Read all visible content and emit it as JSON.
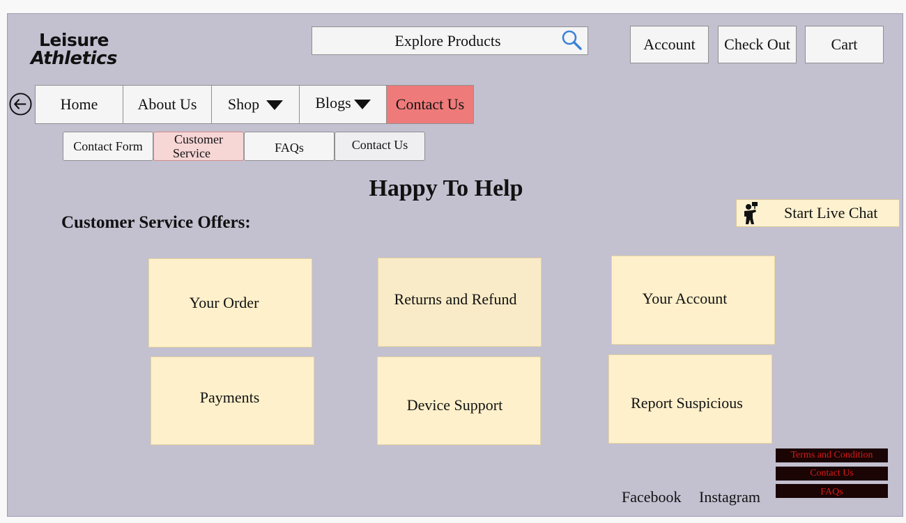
{
  "brand": {
    "line1": "Leisure",
    "line2": "Athletics"
  },
  "search": {
    "label": "Explore Products",
    "icon": "search-icon"
  },
  "header_buttons": {
    "account": "Account",
    "checkout": "Check Out",
    "cart": "Cart"
  },
  "nav": {
    "back_icon": "arrow-left-circle-icon",
    "items": [
      {
        "label": "Home"
      },
      {
        "label": "About Us"
      },
      {
        "label": "Shop"
      },
      {
        "label": "Blogs"
      },
      {
        "label": "Contact Us"
      }
    ]
  },
  "subnav": {
    "contact_form": "Contact Form",
    "customer_service_1": "Customer",
    "customer_service_2": "Service",
    "faqs": "FAQs",
    "contact_us": "Contact Us"
  },
  "main": {
    "title": "Happy To Help",
    "offers_heading": "Customer Service Offers:",
    "live_chat": "Start Live Chat",
    "cards": [
      "Your Order",
      "Returns and Refund",
      "Your Account",
      "Payments",
      "Device Support",
      "Report Suspicious"
    ]
  },
  "footer": {
    "facebook": "Facebook",
    "instagram": "Instagram",
    "terms": "Terms and Condition",
    "contact": "Contact Us",
    "faqs": "FAQs"
  },
  "colors": {
    "background": "#c3c0d0",
    "active_nav": "#ef7a7a",
    "active_subnav": "#f7d6d6",
    "card": "#fef0cb",
    "footer_link_bg": "#1a0404",
    "footer_link_text": "#d91a1a",
    "search_icon": "#3b82d6"
  }
}
